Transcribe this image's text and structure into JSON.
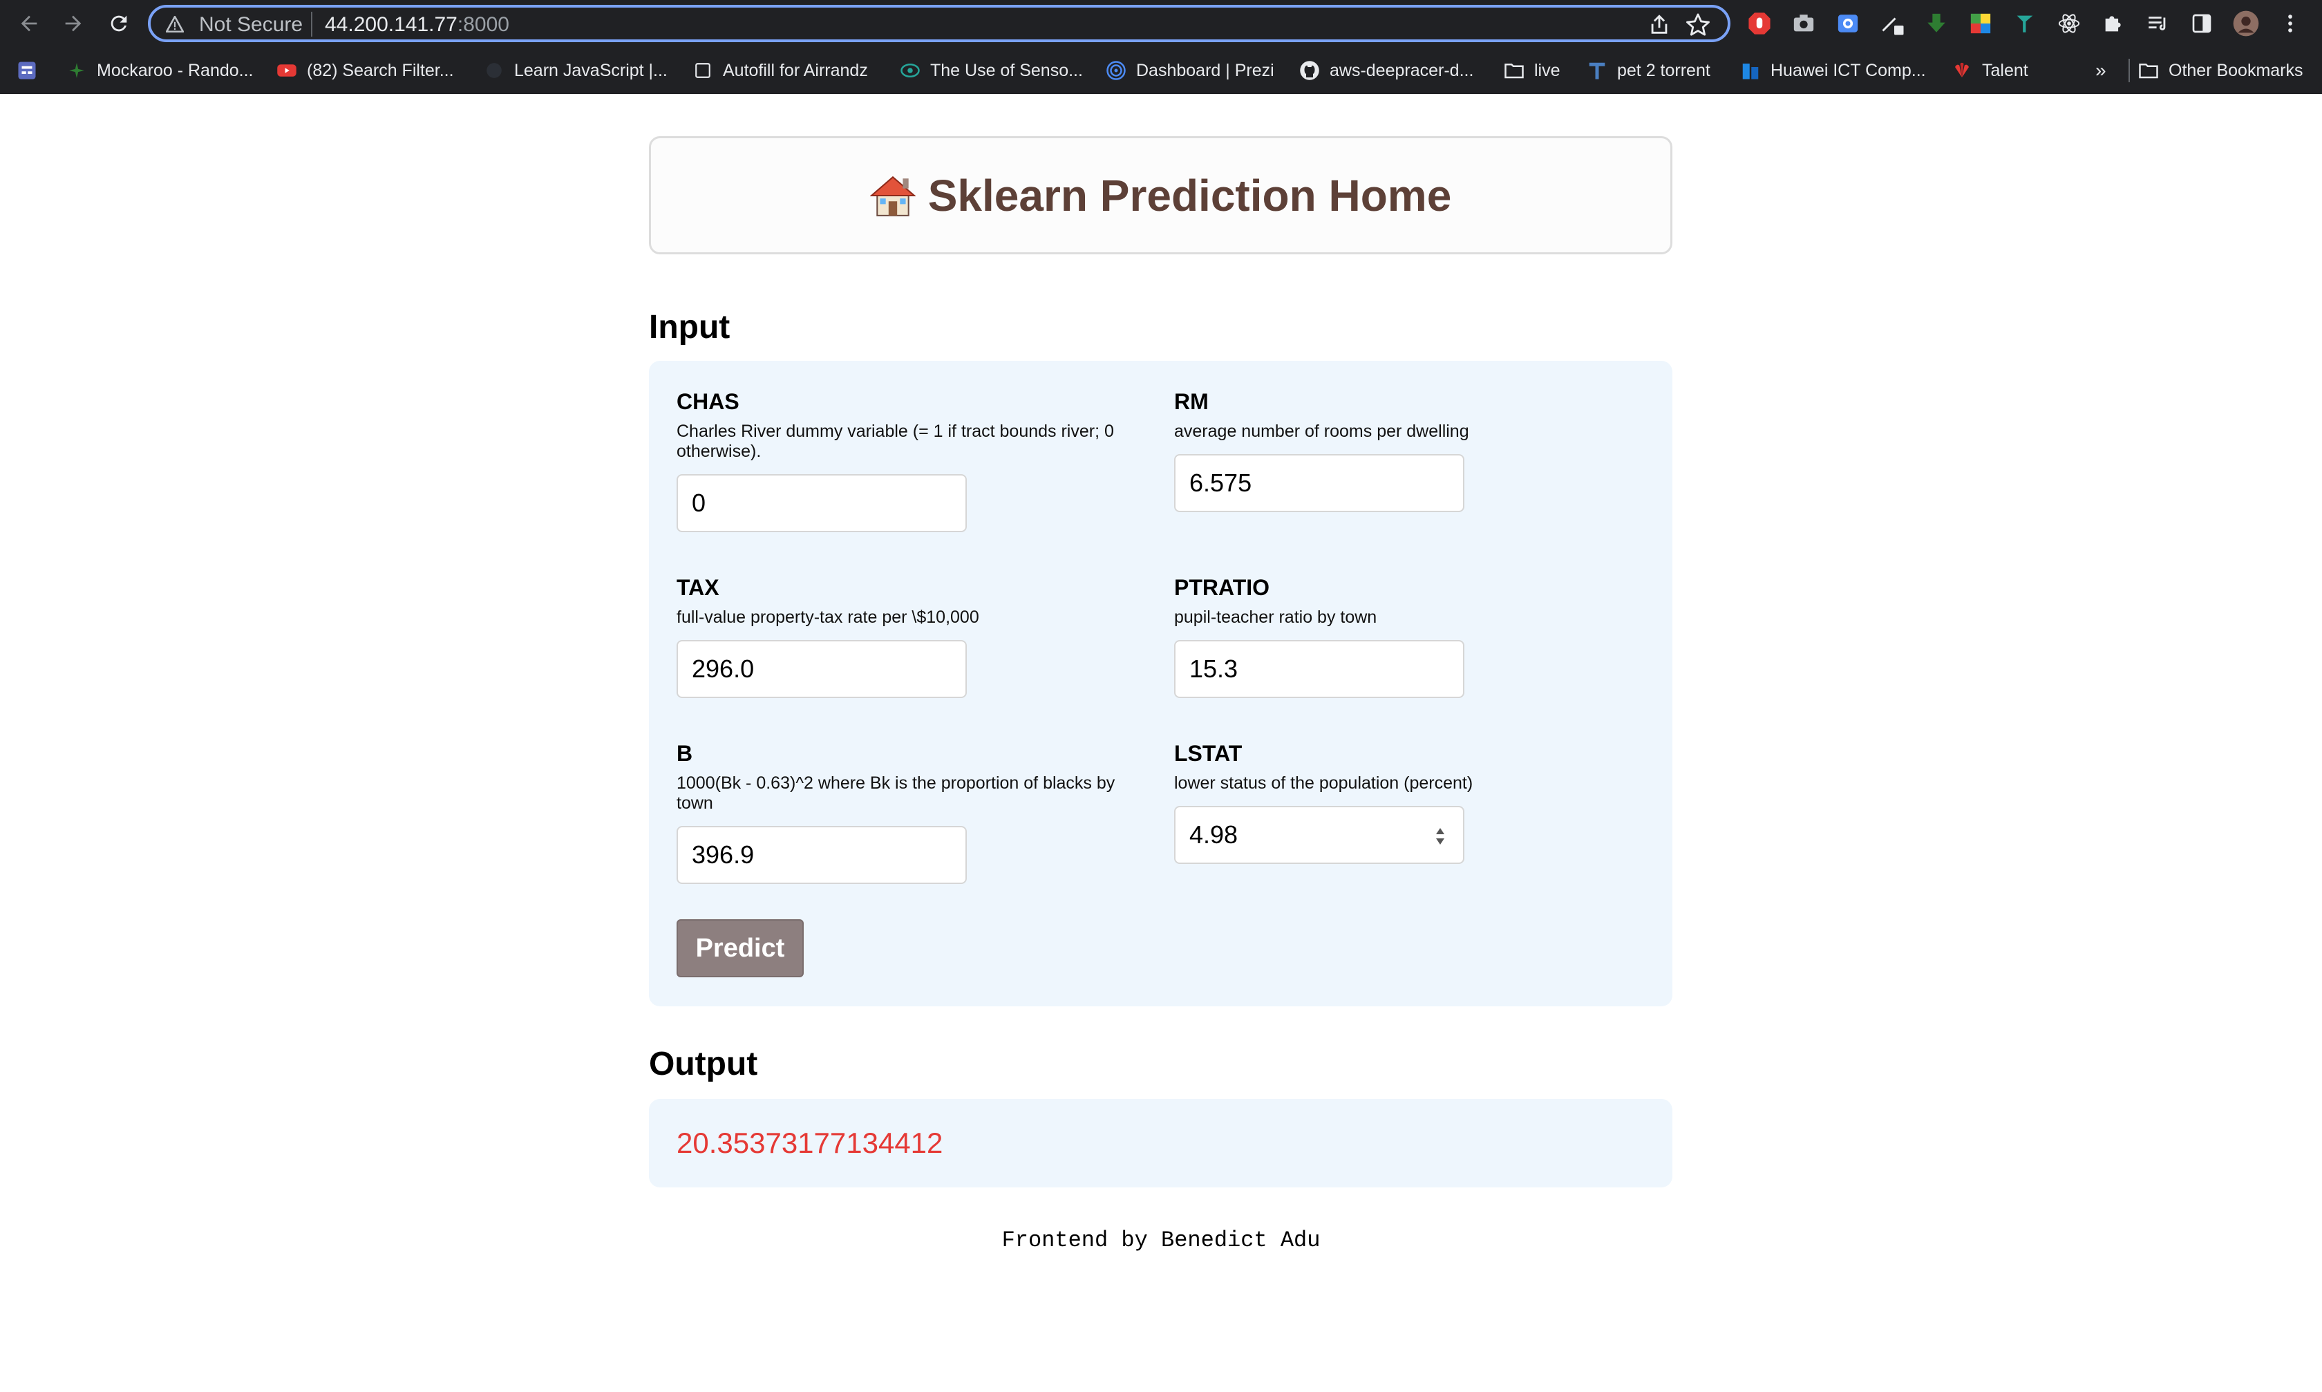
{
  "browser": {
    "security_label": "Not Secure",
    "url_host": "44.200.141.77",
    "url_port": ":8000",
    "bookmarks": [
      {
        "label": "Mockaroo - Rando...",
        "icon": "mockaroo-icon"
      },
      {
        "label": "(82) Search Filter...",
        "icon": "youtube-icon"
      },
      {
        "label": "Learn JavaScript |...",
        "icon": "globe-icon"
      },
      {
        "label": "Autofill for Airrandz",
        "icon": "checkbox-icon"
      },
      {
        "label": "The Use of Senso...",
        "icon": "eye-icon"
      },
      {
        "label": "Dashboard | Prezi",
        "icon": "prezi-icon"
      },
      {
        "label": "aws-deepracer-d...",
        "icon": "github-icon"
      },
      {
        "label": "live",
        "icon": "folder-icon"
      },
      {
        "label": "pet 2 torrent",
        "icon": "t-icon"
      },
      {
        "label": "Huawei ICT Comp...",
        "icon": "huawei-blue-icon"
      },
      {
        "label": "Talent",
        "icon": "huawei-icon"
      }
    ],
    "overflow_label": "»",
    "other_bookmarks": "Other Bookmarks"
  },
  "header": {
    "title": "Sklearn Prediction Home",
    "icon": "house-icon"
  },
  "input_section": {
    "heading": "Input",
    "fields": [
      {
        "name": "CHAS",
        "description": "Charles River dummy variable (= 1 if tract bounds river; 0 otherwise).",
        "value": "0"
      },
      {
        "name": "RM",
        "description": "average number of rooms per dwelling",
        "value": "6.575"
      },
      {
        "name": "TAX",
        "description": "full-value property-tax rate per \\$10,000",
        "value": "296.0"
      },
      {
        "name": "PTRATIO",
        "description": "pupil-teacher ratio by town",
        "value": "15.3"
      },
      {
        "name": "B",
        "description": "1000(Bk - 0.63)^2 where Bk is the proportion of blacks by town",
        "value": "396.9"
      },
      {
        "name": "LSTAT",
        "description": "lower status of the population (percent)",
        "value": "4.98"
      }
    ],
    "predict_label": "Predict"
  },
  "output_section": {
    "heading": "Output",
    "value": "20.35373177134412"
  },
  "footer": {
    "text": "Frontend by Benedict Adu"
  },
  "colors": {
    "title": "#5d4037",
    "panel_bg": "#eef6fd",
    "output_text": "#e53935",
    "button_bg": "#8d7f7f"
  }
}
